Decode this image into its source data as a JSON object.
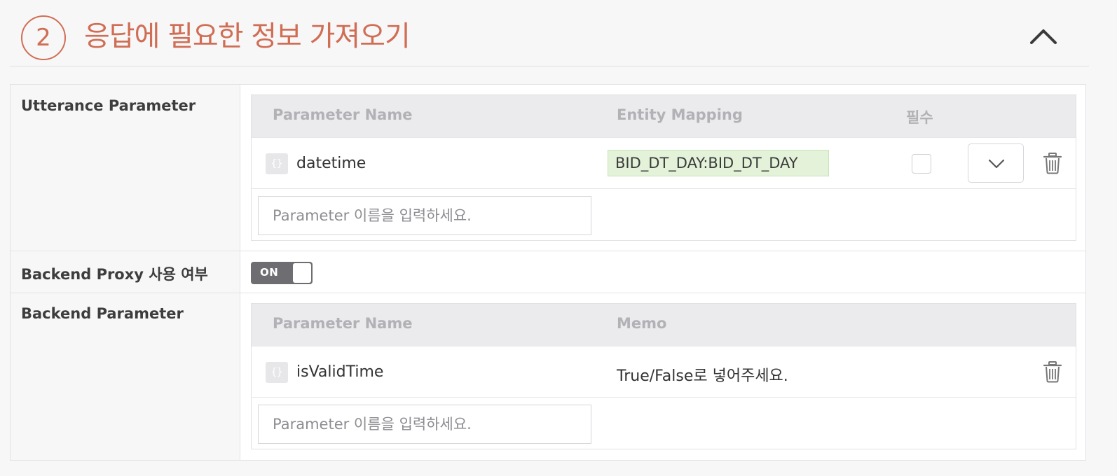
{
  "header": {
    "step_number": "2",
    "title": "응답에 필요한 정보 가져오기"
  },
  "utterance": {
    "label": "Utterance Parameter",
    "columns": {
      "name": "Parameter Name",
      "entity": "Entity Mapping",
      "required": "필수"
    },
    "rows": [
      {
        "badge": "{}",
        "name": "datetime",
        "entity": "BID_DT_DAY:BID_DT_DAY",
        "required": false
      }
    ],
    "input_placeholder": "Parameter 이름을 입력하세요."
  },
  "proxy": {
    "label": "Backend Proxy 사용 여부",
    "toggle_label": "ON",
    "enabled": true
  },
  "backend": {
    "label": "Backend Parameter",
    "columns": {
      "name": "Parameter Name",
      "memo": "Memo"
    },
    "rows": [
      {
        "badge": "{}",
        "name": "isValidTime",
        "memo": "True/False로 넣어주세요."
      }
    ],
    "input_placeholder": "Parameter 이름을 입력하세요."
  },
  "colors": {
    "accent": "#d06e55",
    "entity_chip": "#e3f2d9",
    "toggle_on": "#6e6e72"
  },
  "icons": {
    "collapse": "chevron-up-icon",
    "dropdown": "chevron-down-icon",
    "delete": "trash-icon",
    "param_type": "braces-icon"
  }
}
